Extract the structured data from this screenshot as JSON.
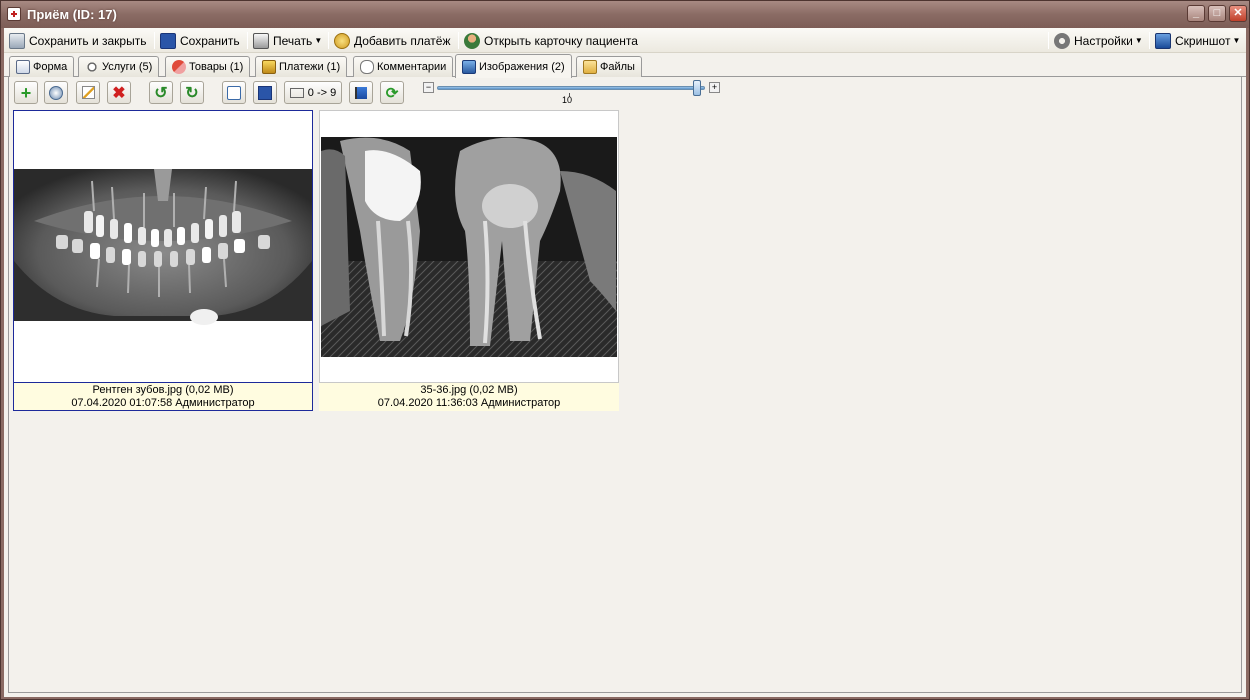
{
  "window": {
    "title": "Приём (ID: 17)",
    "minimize": "_",
    "maximize": "□",
    "close": "✕"
  },
  "toolbar": {
    "save_close": "Сохранить и закрыть",
    "save": "Сохранить",
    "print": "Печать",
    "add_payment": "Добавить платёж",
    "open_card": "Открыть карточку пациента",
    "settings": "Настройки",
    "screenshot": "Скриншот"
  },
  "tabs": [
    {
      "label": "Форма",
      "icon": "form-icon"
    },
    {
      "label": "Услуги (5)",
      "icon": "stethoscope-icon"
    },
    {
      "label": "Товары (1)",
      "icon": "pill-icon"
    },
    {
      "label": "Платежи (1)",
      "icon": "coins-icon"
    },
    {
      "label": "Комментарии",
      "icon": "comment-icon"
    },
    {
      "label": "Изображения (2)",
      "icon": "image-icon",
      "active": true
    },
    {
      "label": "Файлы",
      "icon": "folder-icon"
    }
  ],
  "image_toolbar": {
    "sequence_label": "0 -> 9",
    "zoom": {
      "value": 10,
      "label": "10",
      "minus": "−",
      "plus": "+",
      "fraction": 0.97
    }
  },
  "images": [
    {
      "filename": "Рентген зубов.jpg (0,02 MB)",
      "meta": "07.04.2020 01:07:58  Администратор",
      "selected": true,
      "kind": "panoramic x-ray"
    },
    {
      "filename": "35-36.jpg (0,02 MB)",
      "meta": "07.04.2020 11:36:03  Администратор",
      "selected": false,
      "kind": "periapical x-ray"
    }
  ],
  "colors": {
    "title_bar": "#8a6a63",
    "selection_border": "#1d2a9a",
    "caption_bg": "#fffce0"
  }
}
